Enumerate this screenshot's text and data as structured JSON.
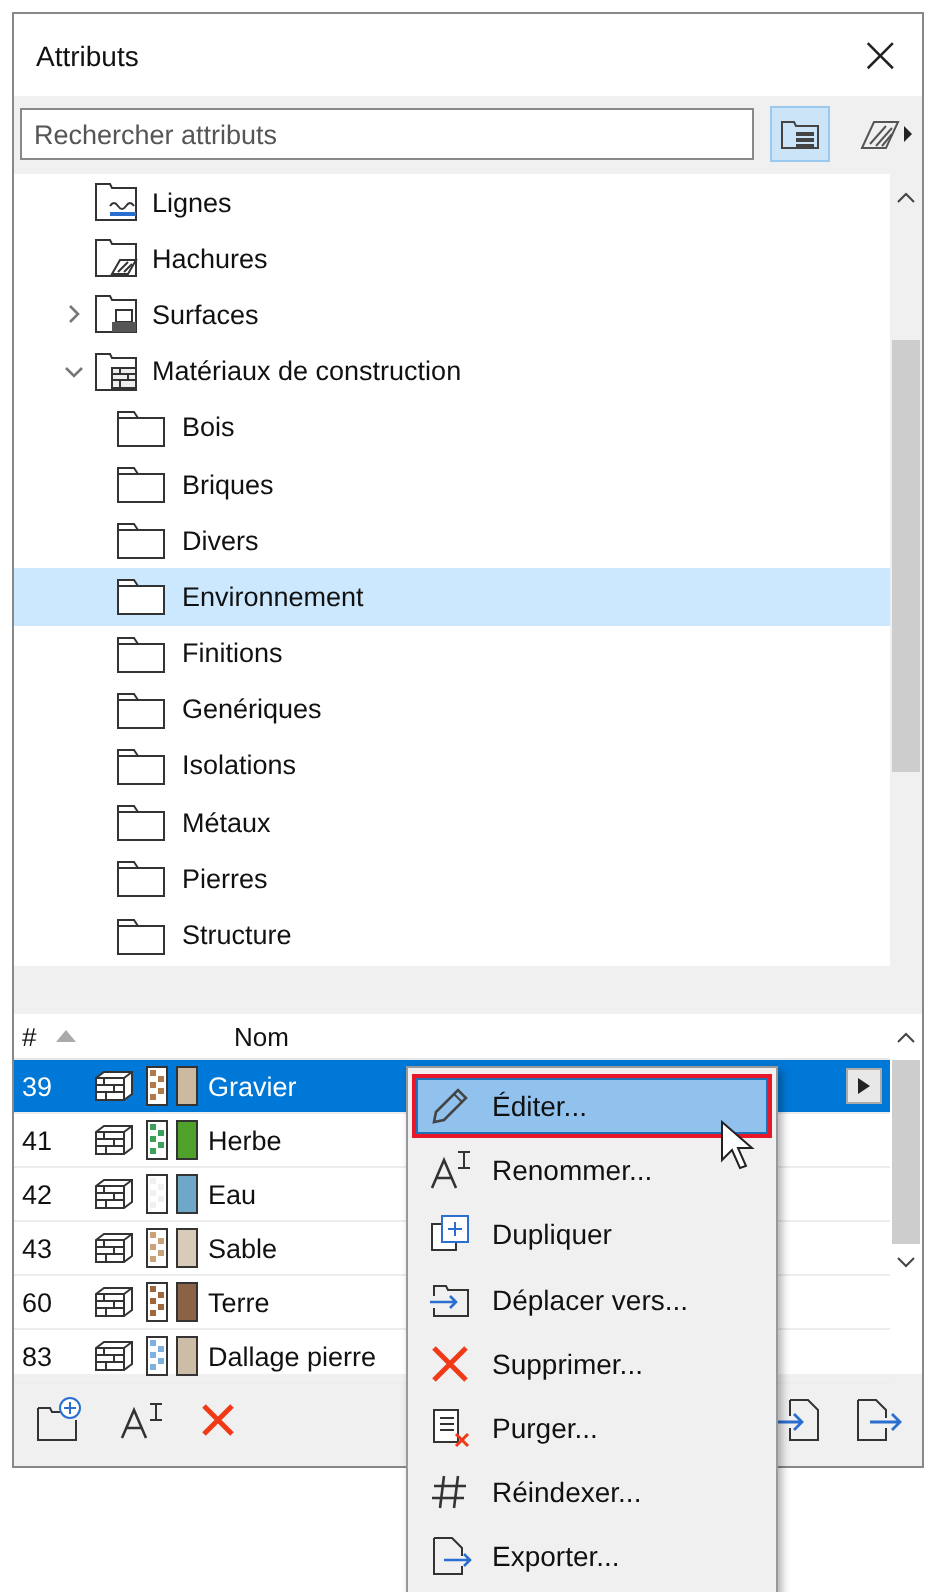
{
  "window": {
    "title": "Attributs",
    "close": "×"
  },
  "search": {
    "placeholder": "Rechercher attributs"
  },
  "tree": [
    {
      "label": "Lignes",
      "kind": "lines",
      "selected": false
    },
    {
      "label": "Hachures",
      "kind": "hatches",
      "selected": false
    },
    {
      "label": "Surfaces",
      "kind": "surfaces",
      "selected": false,
      "expanded": false
    },
    {
      "label": "Matériaux de construction",
      "kind": "materials",
      "selected": false,
      "expanded": true,
      "children": [
        {
          "label": "Bois",
          "selected": false
        },
        {
          "label": "Briques",
          "selected": false
        },
        {
          "label": "Divers",
          "selected": false
        },
        {
          "label": "Environnement",
          "selected": true
        },
        {
          "label": "Finitions",
          "selected": false
        },
        {
          "label": "Genériques",
          "selected": false
        },
        {
          "label": "Isolations",
          "selected": false
        },
        {
          "label": "Métaux",
          "selected": false
        },
        {
          "label": "Pierres",
          "selected": false
        },
        {
          "label": "Structure",
          "selected": false
        }
      ]
    }
  ],
  "table": {
    "columns": [
      "#",
      "Nom"
    ],
    "rows": [
      {
        "number": "39",
        "name": "Gravier",
        "pattern": {
          "color": "#b07a4a"
        },
        "color": "#cbb9a1",
        "selected": true
      },
      {
        "number": "41",
        "name": "Herbe",
        "pattern": {
          "color": "#3aa05a"
        },
        "color": "#4ea12b",
        "selected": false
      },
      {
        "number": "42",
        "name": "Eau",
        "pattern": {
          "color": "#f0f0f0"
        },
        "color": "#6fa7c9",
        "selected": false
      },
      {
        "number": "43",
        "name": "Sable",
        "pattern": {
          "color": "#c9a27a"
        },
        "color": "#d8cbb8",
        "selected": false
      },
      {
        "number": "60",
        "name": "Terre",
        "pattern": {
          "color": "#a0673c"
        },
        "color": "#8c6246",
        "selected": false
      },
      {
        "number": "83",
        "name": "Dallage pierre",
        "pattern": {
          "color": "#7fb0e0"
        },
        "color": "#cdbda6",
        "selected": false
      }
    ]
  },
  "context_menu": [
    {
      "label": "Éditer...",
      "kind": "edit",
      "selected": true
    },
    {
      "label": "Renommer...",
      "kind": "rename",
      "selected": false
    },
    {
      "label": "Dupliquer",
      "kind": "duplicate",
      "selected": false
    },
    {
      "label": "Déplacer vers...",
      "kind": "move",
      "selected": false
    },
    {
      "label": "Supprimer...",
      "kind": "delete",
      "selected": false
    },
    {
      "label": "Purger...",
      "kind": "purge",
      "selected": false
    },
    {
      "label": "Réindexer...",
      "kind": "reindex",
      "selected": false
    },
    {
      "label": "Exporter...",
      "kind": "export",
      "selected": false
    }
  ]
}
